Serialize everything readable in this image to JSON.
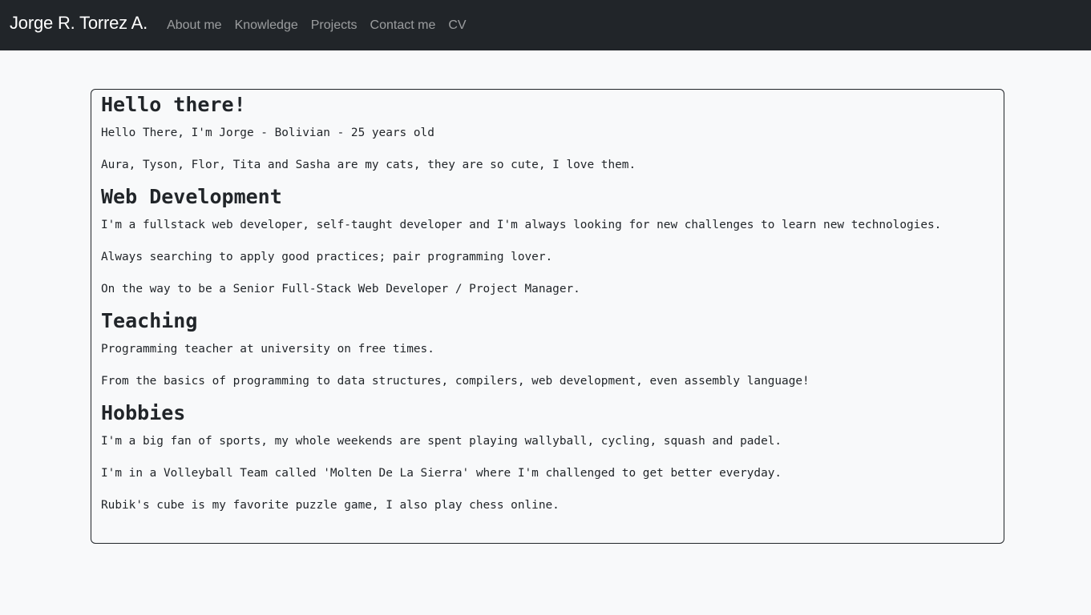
{
  "navbar": {
    "brand": "Jorge R. Torrez A.",
    "links": [
      "About me",
      "Knowledge",
      "Projects",
      "Contact me",
      "CV"
    ]
  },
  "sections": [
    {
      "heading": "Hello there!",
      "paragraphs": [
        "Hello There, I'm Jorge - Bolivian - 25 years old",
        "Aura, Tyson, Flor, Tita and Sasha are my cats, they are so cute, I love them."
      ]
    },
    {
      "heading": "Web Development",
      "paragraphs": [
        "I'm a fullstack web developer, self-taught developer and I'm always looking for new challenges to learn new technologies.",
        "Always searching to apply good practices; pair programming lover.",
        "On the way to be a Senior Full-Stack Web Developer / Project Manager."
      ]
    },
    {
      "heading": "Teaching",
      "paragraphs": [
        "Programming teacher at university on free times.",
        "From the basics of programming to data structures, compilers, web development, even assembly language!"
      ]
    },
    {
      "heading": "Hobbies",
      "paragraphs": [
        "I'm a big fan of sports, my whole weekends are spent playing wallyball, cycling, squash and padel.",
        "I'm in a Volleyball Team called 'Molten De La Sierra' where I'm challenged to get better everyday.",
        "Rubik's cube is my favorite puzzle game, I also play chess online."
      ]
    }
  ]
}
